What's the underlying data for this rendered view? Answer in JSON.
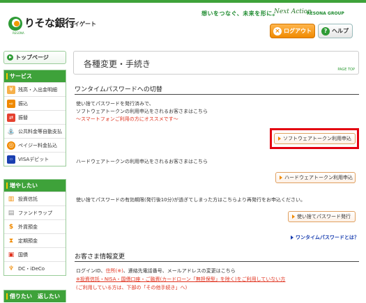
{
  "header": {
    "brand": "りそな銀行",
    "brand_sub": "マイゲート",
    "logo_small": "RESONA",
    "tagline": "想いをつなぐ、未来を形に。",
    "brand_script": "Next Action",
    "brand_group": "RESONA GROUP",
    "logout_label": "ログアウト",
    "help_label": "ヘルプ"
  },
  "sidebar": {
    "top_label": "トップページ",
    "service_head": "サービス",
    "service_items": [
      {
        "label": "残高・入出金明細",
        "icon": "passbook-icon"
      },
      {
        "label": "振込",
        "icon": "transfer-icon"
      },
      {
        "label": "振替",
        "icon": "swap-icon"
      },
      {
        "label": "公共料金等自動支払",
        "icon": "faucet-icon"
      },
      {
        "label": "ペイジー料金払込",
        "icon": "payeasy-icon"
      },
      {
        "label": "VISAデビット",
        "icon": "card-icon"
      }
    ],
    "increase_head": "増やしたい",
    "increase_items": [
      {
        "label": "投資信託",
        "icon": "chart-icon"
      },
      {
        "label": "ファンドラップ",
        "icon": "wrap-icon"
      },
      {
        "label": "外貨預金",
        "icon": "dollar-icon"
      },
      {
        "label": "定期預金",
        "icon": "deposit-icon"
      },
      {
        "label": "国債",
        "icon": "bond-icon"
      },
      {
        "label": "DC・iDeCo",
        "icon": "pension-icon"
      }
    ],
    "borrow_head": "借りたい　返したい"
  },
  "main": {
    "title": "各種変更・手続き",
    "pagetop": "PAGE TOP",
    "section1": {
      "title": "ワンタイムパスワードへの切替",
      "text1a": "使い捨てパスワードを発行済みで、",
      "text1b": "ソフトウェアトークンの利用申込をされるお客さまはこちら",
      "note": "～スマートフォンご利用の方にオススメです～",
      "btn_software": "ソフトウェアトークン利用申込",
      "text2": "ハードウェアトークンの利用申込をされるお客さまはこちら",
      "btn_hardware": "ハードウェアトークン利用申込",
      "text3": "使い捨てパスワードの有効期限(発行後10分)が過ぎてしまった方はこちらより再発行をお申込ください。",
      "btn_reissue": "使い捨てパスワード発行",
      "link_whatis": "ワンタイムパスワードとは？"
    },
    "section2": {
      "title": "お客さま情報変更",
      "text1_pre": "ログインID、",
      "text1_red": "住所(※)",
      "text1_post": "、連絡先電話番号、メールアドレスの変更はこちら",
      "text2": "※投資信託・NISA・国債口座・ご融資(カードローン「無担保型」を除く)をご利用していない方",
      "text3": "(ご利用している方は、下部の「その他手続き」へ)"
    }
  },
  "colors": {
    "brand_green": "#3ea23a",
    "accent_orange": "#f08a00",
    "highlight_red": "#e3000f",
    "link_blue": "#1a3fb0",
    "warn_red": "#e0321e"
  }
}
